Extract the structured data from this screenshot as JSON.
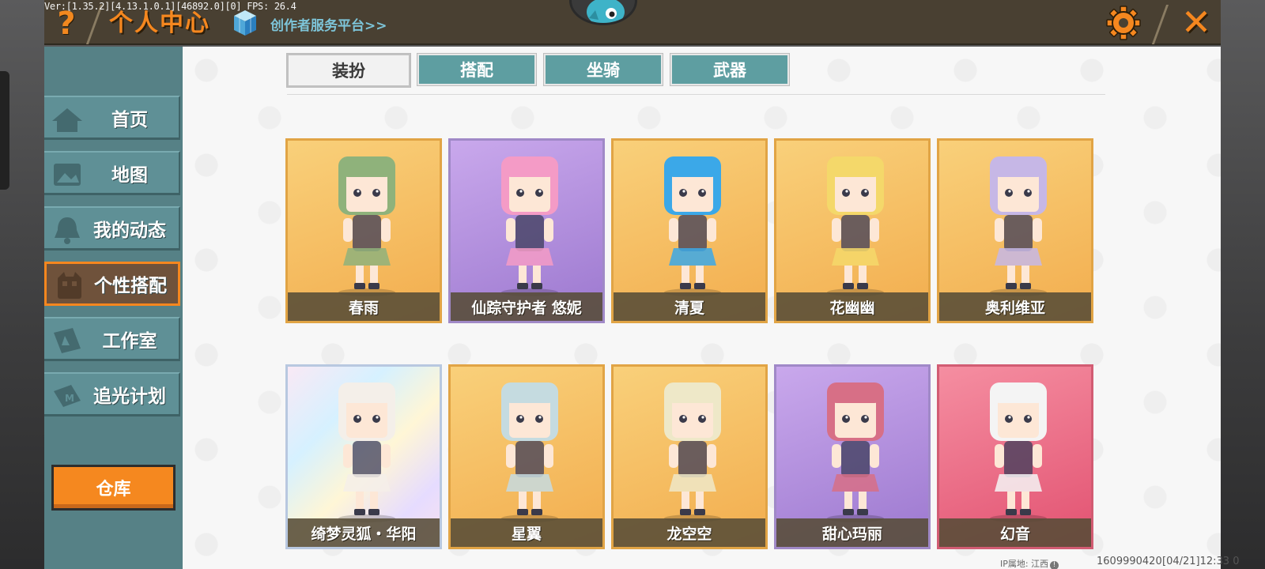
{
  "debug_text": "Ver:[1.35.2][4.13.1.0.1][46892.0][0] FPS: 26.4",
  "header": {
    "help_label": "?",
    "title": "个人中心",
    "creator_link": "创作者服务平台>>",
    "close_label": "✕"
  },
  "sidebar": {
    "items": [
      {
        "label": "首页",
        "icon": "home-icon"
      },
      {
        "label": "地图",
        "icon": "map-icon"
      },
      {
        "label": "我的动态",
        "icon": "bell-icon"
      },
      {
        "label": "个性搭配",
        "icon": "outfit-icon",
        "active": true
      },
      {
        "label": "工作室",
        "icon": "studio-icon"
      },
      {
        "label": "追光计划",
        "icon": "plan-icon"
      }
    ],
    "warehouse_label": "仓库"
  },
  "tabs": [
    {
      "label": "装扮",
      "active": true
    },
    {
      "label": "搭配"
    },
    {
      "label": "坐骑"
    },
    {
      "label": "武器"
    }
  ],
  "skins": [
    {
      "name": "春雨",
      "theme": "orange",
      "hair": "#8fb27b"
    },
    {
      "name": "仙踪守护者 悠妮",
      "theme": "purple",
      "hair": "#f49bc6"
    },
    {
      "name": "清夏",
      "theme": "orange",
      "hair": "#3ba8e8"
    },
    {
      "name": "花幽幽",
      "theme": "orange",
      "hair": "#f4d86a"
    },
    {
      "name": "奥利维亚",
      "theme": "orange",
      "hair": "#c6b7e6"
    },
    {
      "name": "绮梦灵狐・华阳",
      "theme": "holo",
      "hair": "#f4efe9"
    },
    {
      "name": "星翼",
      "theme": "orange",
      "hair": "#c5dbe0"
    },
    {
      "name": "龙空空",
      "theme": "orange",
      "hair": "#eee8c8"
    },
    {
      "name": "甜心玛丽",
      "theme": "purple",
      "hair": "#d76f86"
    },
    {
      "name": "幻音",
      "theme": "red",
      "hair": "#f4f4f4"
    }
  ],
  "footer": {
    "ip_location": "IP属地: 江西",
    "user_id": "1609990420",
    "time": "[04/21]12:33 0"
  },
  "colors": {
    "accent_orange": "#f5871f",
    "sidebar_teal": "#5f9096",
    "tab_teal": "#5e9ea1"
  }
}
